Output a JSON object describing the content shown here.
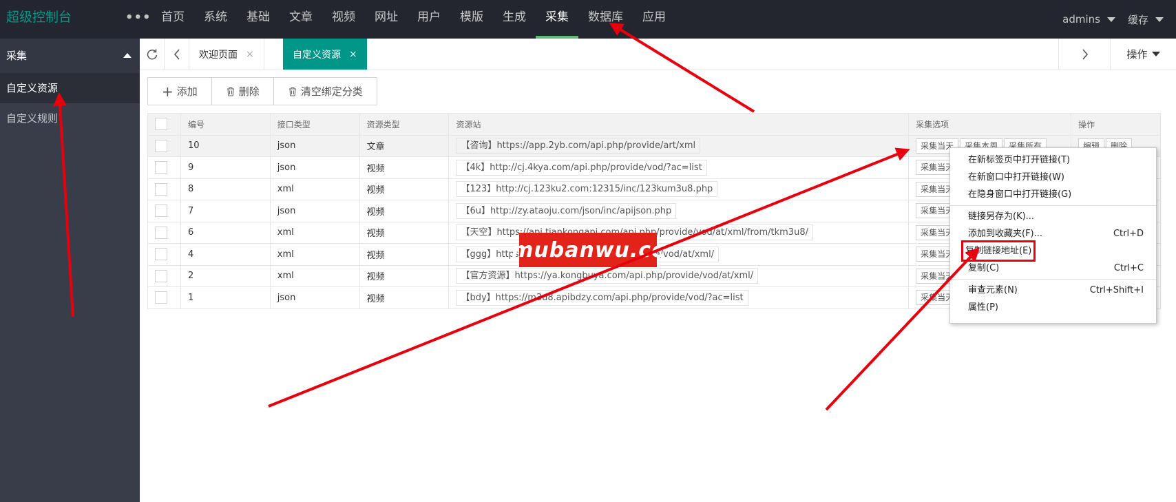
{
  "app": {
    "title": "超级控制台",
    "more": "•••"
  },
  "nav": [
    "首页",
    "系统",
    "基础",
    "文章",
    "视频",
    "网址",
    "用户",
    "模版",
    "生成",
    "采集",
    "数据库",
    "应用"
  ],
  "user": {
    "name": "admins",
    "cache": "缓存"
  },
  "sidebar": {
    "section": "采集",
    "items": [
      "自定义资源",
      "自定义规则"
    ]
  },
  "tabs": {
    "welcome": "欢迎页面",
    "custom": "自定义资源",
    "close": "×",
    "operate": "操作"
  },
  "toolbar": {
    "add": "添加",
    "delete": "删除",
    "clear": "清空绑定分类"
  },
  "table": {
    "headers": [
      "编号",
      "接口类型",
      "资源类型",
      "资源站",
      "采集选项",
      "操作"
    ],
    "rows": [
      {
        "id": "10",
        "api": "json",
        "type": "文章",
        "site": "【咨询】https://app.2yb.com/api.php/provide/art/xml"
      },
      {
        "id": "9",
        "api": "json",
        "type": "视频",
        "site": "【4k】http://cj.4kya.com/api.php/provide/vod/?ac=list"
      },
      {
        "id": "8",
        "api": "xml",
        "type": "视频",
        "site": "【123】http://cj.123ku2.com:12315/inc/123kum3u8.php"
      },
      {
        "id": "7",
        "api": "json",
        "type": "视频",
        "site": "【6u】http://zy.ataoju.com/json/inc/apijson.php"
      },
      {
        "id": "6",
        "api": "xml",
        "type": "视频",
        "site": "【天空】https://api.tiankongapi.com/api.php/provide/vod/at/xml/from/tkm3u8/"
      },
      {
        "id": "4",
        "api": "xml",
        "type": "视频",
        "site": "【ggg】https://ggg.ggg.com/api.php/provide/vod/at/xml/"
      },
      {
        "id": "2",
        "api": "xml",
        "type": "视频",
        "site": "【官方资源】https://ya.kongbuya.com/api.php/provide/vod/at/xml/"
      },
      {
        "id": "1",
        "api": "json",
        "type": "视频",
        "site": "【bdy】https://m3u8.apibdzy.com/api.php/provide/vod/?ac=list"
      }
    ],
    "collect_today": "采集当天",
    "collect_week": "采集本周",
    "collect_all": "采集所有",
    "edit": "编辑",
    "remove": "删除"
  },
  "context_menu": [
    {
      "label": "在新标签页中打开链接(T)",
      "shortcut": ""
    },
    {
      "label": "在新窗口中打开链接(W)",
      "shortcut": ""
    },
    {
      "label": "在隐身窗口中打开链接(G)",
      "shortcut": ""
    },
    {
      "label": "链接另存为(K)...",
      "shortcut": ""
    },
    {
      "label": "添加到收藏夹(F)...",
      "shortcut": "Ctrl+D"
    },
    {
      "label": "复制链接地址(E)",
      "shortcut": ""
    },
    {
      "label": "复制(C)",
      "shortcut": "Ctrl+C"
    },
    {
      "label": "审查元素(N)",
      "shortcut": "Ctrl+Shift+I"
    },
    {
      "label": "属性(P)",
      "shortcut": ""
    }
  ],
  "watermark": "mubanwu.cc",
  "colors": {
    "accent": "#009688",
    "nav_active": "#5fb878",
    "annotation": "#e8000d"
  }
}
